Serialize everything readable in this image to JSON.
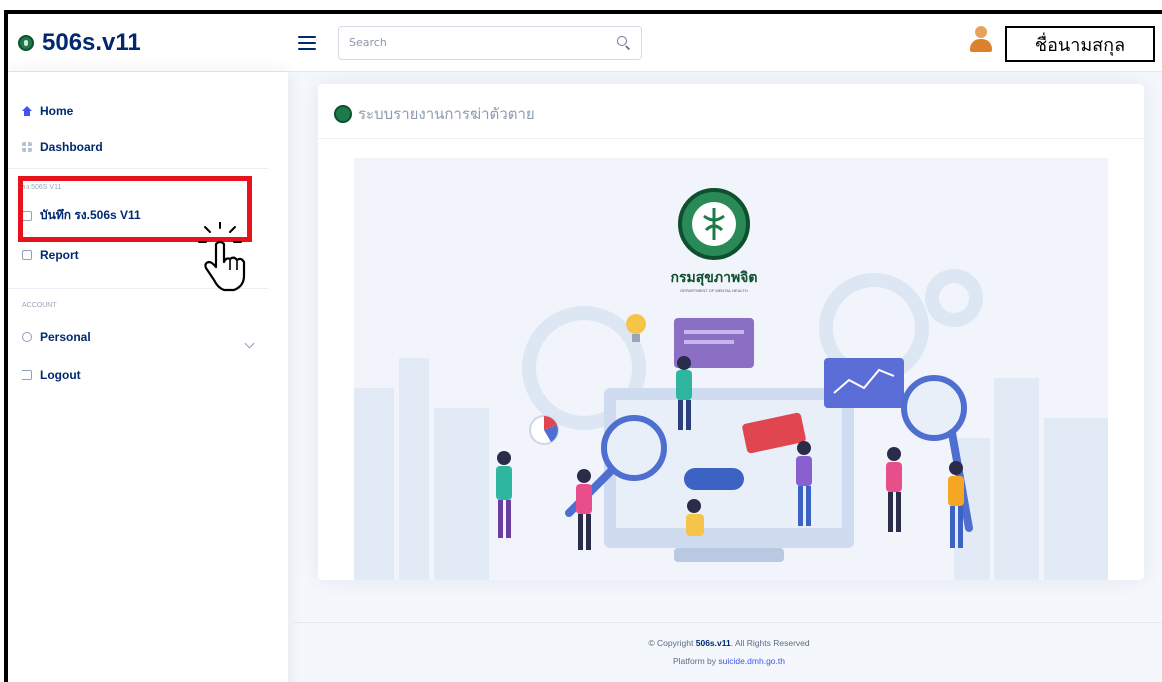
{
  "header": {
    "brand": "506s.v11",
    "search_placeholder": "Search",
    "user_name": "ชื่อนามสกุล"
  },
  "sidebar": {
    "items": [
      {
        "label": "Home",
        "icon": "home-icon"
      },
      {
        "label": "Dashboard",
        "icon": "grid-icon"
      }
    ],
    "section1_heading": "รง.506s V11",
    "section1_items": [
      {
        "label": "บันทึก รง.506s V11",
        "icon": "document-icon"
      },
      {
        "label": "Report",
        "icon": "report-icon"
      }
    ],
    "section2_heading": "ACCOUNT",
    "section2_items": [
      {
        "label": "Personal",
        "icon": "person-icon"
      },
      {
        "label": "Logout",
        "icon": "logout-icon"
      }
    ]
  },
  "main": {
    "card_title": "ระบบรายงานการฆ่าตัวตาย",
    "dept_name_th": "กรมสุขภาพจิต",
    "dept_name_en": "DEPARTMENT OF MENTAL HEALTH"
  },
  "footer": {
    "copyright_prefix": "© Copyright ",
    "copyright_brand": "506s.v11",
    "copyright_suffix": ". All Rights Reserved",
    "platform_prefix": "Platform by ",
    "platform_link": "suicide.dmh.go.th"
  },
  "colors": {
    "brand": "#012970",
    "accent": "#4154f1",
    "highlight_red": "#e8121a",
    "logo_green": "#1d7a4a"
  }
}
